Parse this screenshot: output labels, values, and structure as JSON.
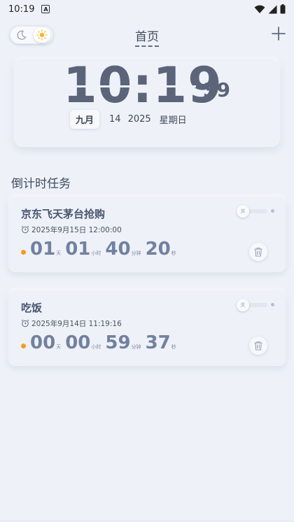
{
  "status_bar": {
    "time": "10:19",
    "app_icon_letter": "A"
  },
  "header": {
    "title": "首页"
  },
  "clock": {
    "time": "10:19",
    "seconds": "39",
    "month": "九月",
    "day": "14",
    "year": "2025",
    "weekday": "星期日"
  },
  "section_title": "倒计时任务",
  "tasks": [
    {
      "name": "京东飞天茅台抢购",
      "target": "2025年9月15日 12:00:00",
      "toggle_label": "关",
      "days": "01",
      "days_unit": "天",
      "hours": "01",
      "hours_unit": "小时",
      "minutes": "40",
      "minutes_unit": "分钟",
      "seconds": "20",
      "seconds_unit": "秒"
    },
    {
      "name": "吃饭",
      "target": "2025年9月14日 11:19:16",
      "toggle_label": "关",
      "days": "00",
      "days_unit": "天",
      "hours": "00",
      "hours_unit": "小时",
      "minutes": "59",
      "minutes_unit": "分钟",
      "seconds": "37",
      "seconds_unit": "秒"
    }
  ],
  "colors": {
    "background": "#eef2f8",
    "accent_dot": "#f39c22",
    "clock_text": "#5b6479",
    "countdown_text": "#7381a0"
  }
}
